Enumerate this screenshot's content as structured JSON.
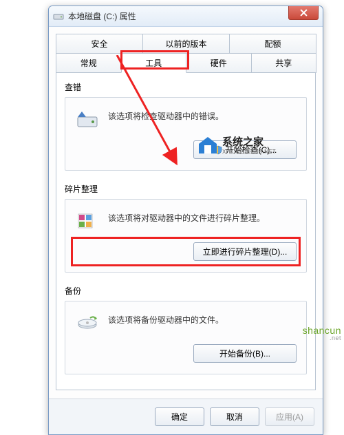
{
  "window": {
    "title": "本地磁盘 (C:) 属性"
  },
  "tabs": {
    "row1": [
      "安全",
      "以前的版本",
      "配额"
    ],
    "row2": [
      "常规",
      "工具",
      "硬件",
      "共享"
    ],
    "active": "工具"
  },
  "groups": {
    "check": {
      "label": "查错",
      "desc": "该选项将检查驱动器中的错误。",
      "button": "开始检查(C)..."
    },
    "defrag": {
      "label": "碎片整理",
      "desc": "该选项将对驱动器中的文件进行碎片整理。",
      "button": "立即进行碎片整理(D)..."
    },
    "backup": {
      "label": "备份",
      "desc": "该选项将备份驱动器中的文件。",
      "button": "开始备份(B)..."
    }
  },
  "footer": {
    "ok": "确定",
    "cancel": "取消",
    "apply": "应用(A)"
  },
  "watermark": {
    "name": "系统之家",
    "sub": "XITONGZHIJIA.NET"
  },
  "shancun": {
    "main": "shancun",
    "sub": ".net"
  }
}
